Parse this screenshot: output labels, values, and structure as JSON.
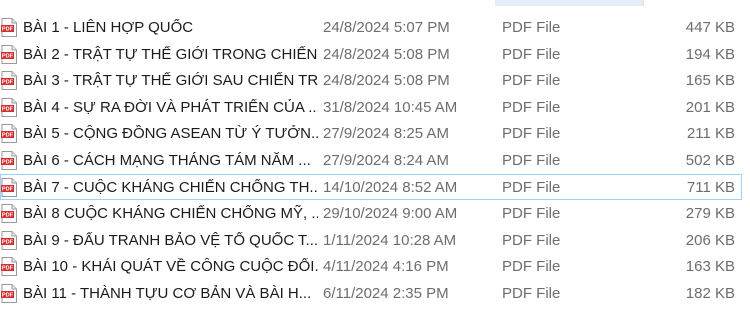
{
  "files": [
    {
      "name": "BÀI 1 - LIÊN HỢP QUỐC",
      "date": "24/8/2024 5:07 PM",
      "type": "PDF File",
      "size": "447 KB",
      "selected": false
    },
    {
      "name": "BÀI 2 - TRẬT TỰ THẾ GIỚI TRONG CHIẾN...",
      "date": "24/8/2024 5:08 PM",
      "type": "PDF File",
      "size": "194 KB",
      "selected": false
    },
    {
      "name": "BÀI 3 - TRẬT TỰ THẾ GIỚI SAU CHIẾN TR...",
      "date": "24/8/2024 5:08 PM",
      "type": "PDF File",
      "size": "165 KB",
      "selected": false
    },
    {
      "name": "BÀI 4 - SỰ RA ĐỜI VÀ PHÁT TRIỂN CỦA ...",
      "date": "31/8/2024 10:45 AM",
      "type": "PDF File",
      "size": "201 KB",
      "selected": false
    },
    {
      "name": "BÀI 5 - CỘNG ĐỒNG ASEAN TỪ Ý TƯỞN...",
      "date": "27/9/2024 8:25 AM",
      "type": "PDF File",
      "size": "211 KB",
      "selected": false
    },
    {
      "name": "BÀI 6 - CÁCH MẠNG THÁNG TÁM NĂM ...",
      "date": "27/9/2024 8:24 AM",
      "type": "PDF File",
      "size": "502 KB",
      "selected": false
    },
    {
      "name": "BÀI 7 - CUỘC KHÁNG CHIẾN CHỐNG TH...",
      "date": "14/10/2024 8:52 AM",
      "type": "PDF File",
      "size": "711 KB",
      "selected": true
    },
    {
      "name": "BÀI 8 CUỘC KHÁNG CHIẾN CHỐNG MỸ, ...",
      "date": "29/10/2024 9:00 AM",
      "type": "PDF File",
      "size": "279 KB",
      "selected": false
    },
    {
      "name": "BÀI 9 - ĐẤU TRANH BẢO VỆ TỔ QUỐC T...",
      "date": "1/11/2024 10:28 AM",
      "type": "PDF File",
      "size": "206 KB",
      "selected": false
    },
    {
      "name": "BÀI 10 - KHÁI QUÁT VỀ CÔNG CUỘC ĐỔI...",
      "date": "4/11/2024 4:16 PM",
      "type": "PDF File",
      "size": "163 KB",
      "selected": false
    },
    {
      "name": "BÀI 11 - THÀNH TỰU CƠ BẢN VÀ BÀI H...",
      "date": "6/11/2024 2:35 PM",
      "type": "PDF File",
      "size": "182 KB",
      "selected": false
    }
  ],
  "icon": {
    "name": "pdf-file-icon",
    "label": "PDF",
    "color": "#d32f2f"
  }
}
